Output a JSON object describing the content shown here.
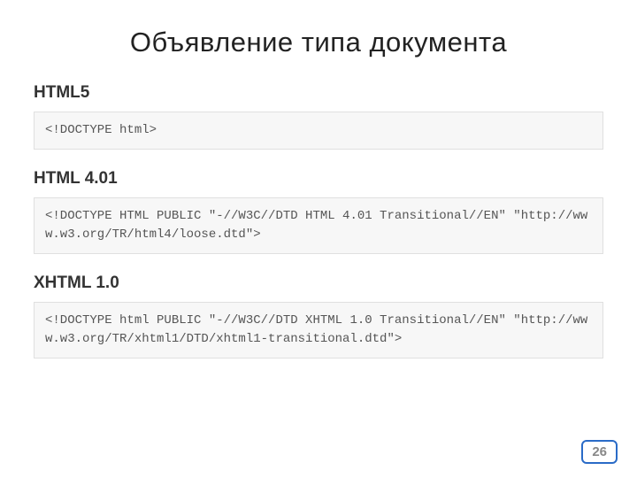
{
  "title": "Объявление типа документа",
  "sections": [
    {
      "heading": "HTML5",
      "code": "<!DOCTYPE html>"
    },
    {
      "heading": "HTML 4.01",
      "code": "<!DOCTYPE HTML PUBLIC \"-//W3C//DTD HTML 4.01 Transitional//EN\" \"http://www.w3.org/TR/html4/loose.dtd\">"
    },
    {
      "heading": "XHTML 1.0",
      "code": "<!DOCTYPE html PUBLIC \"-//W3C//DTD XHTML 1.0 Transitional//EN\" \"http://www.w3.org/TR/xhtml1/DTD/xhtml1-transitional.dtd\">"
    }
  ],
  "page_number": "26"
}
